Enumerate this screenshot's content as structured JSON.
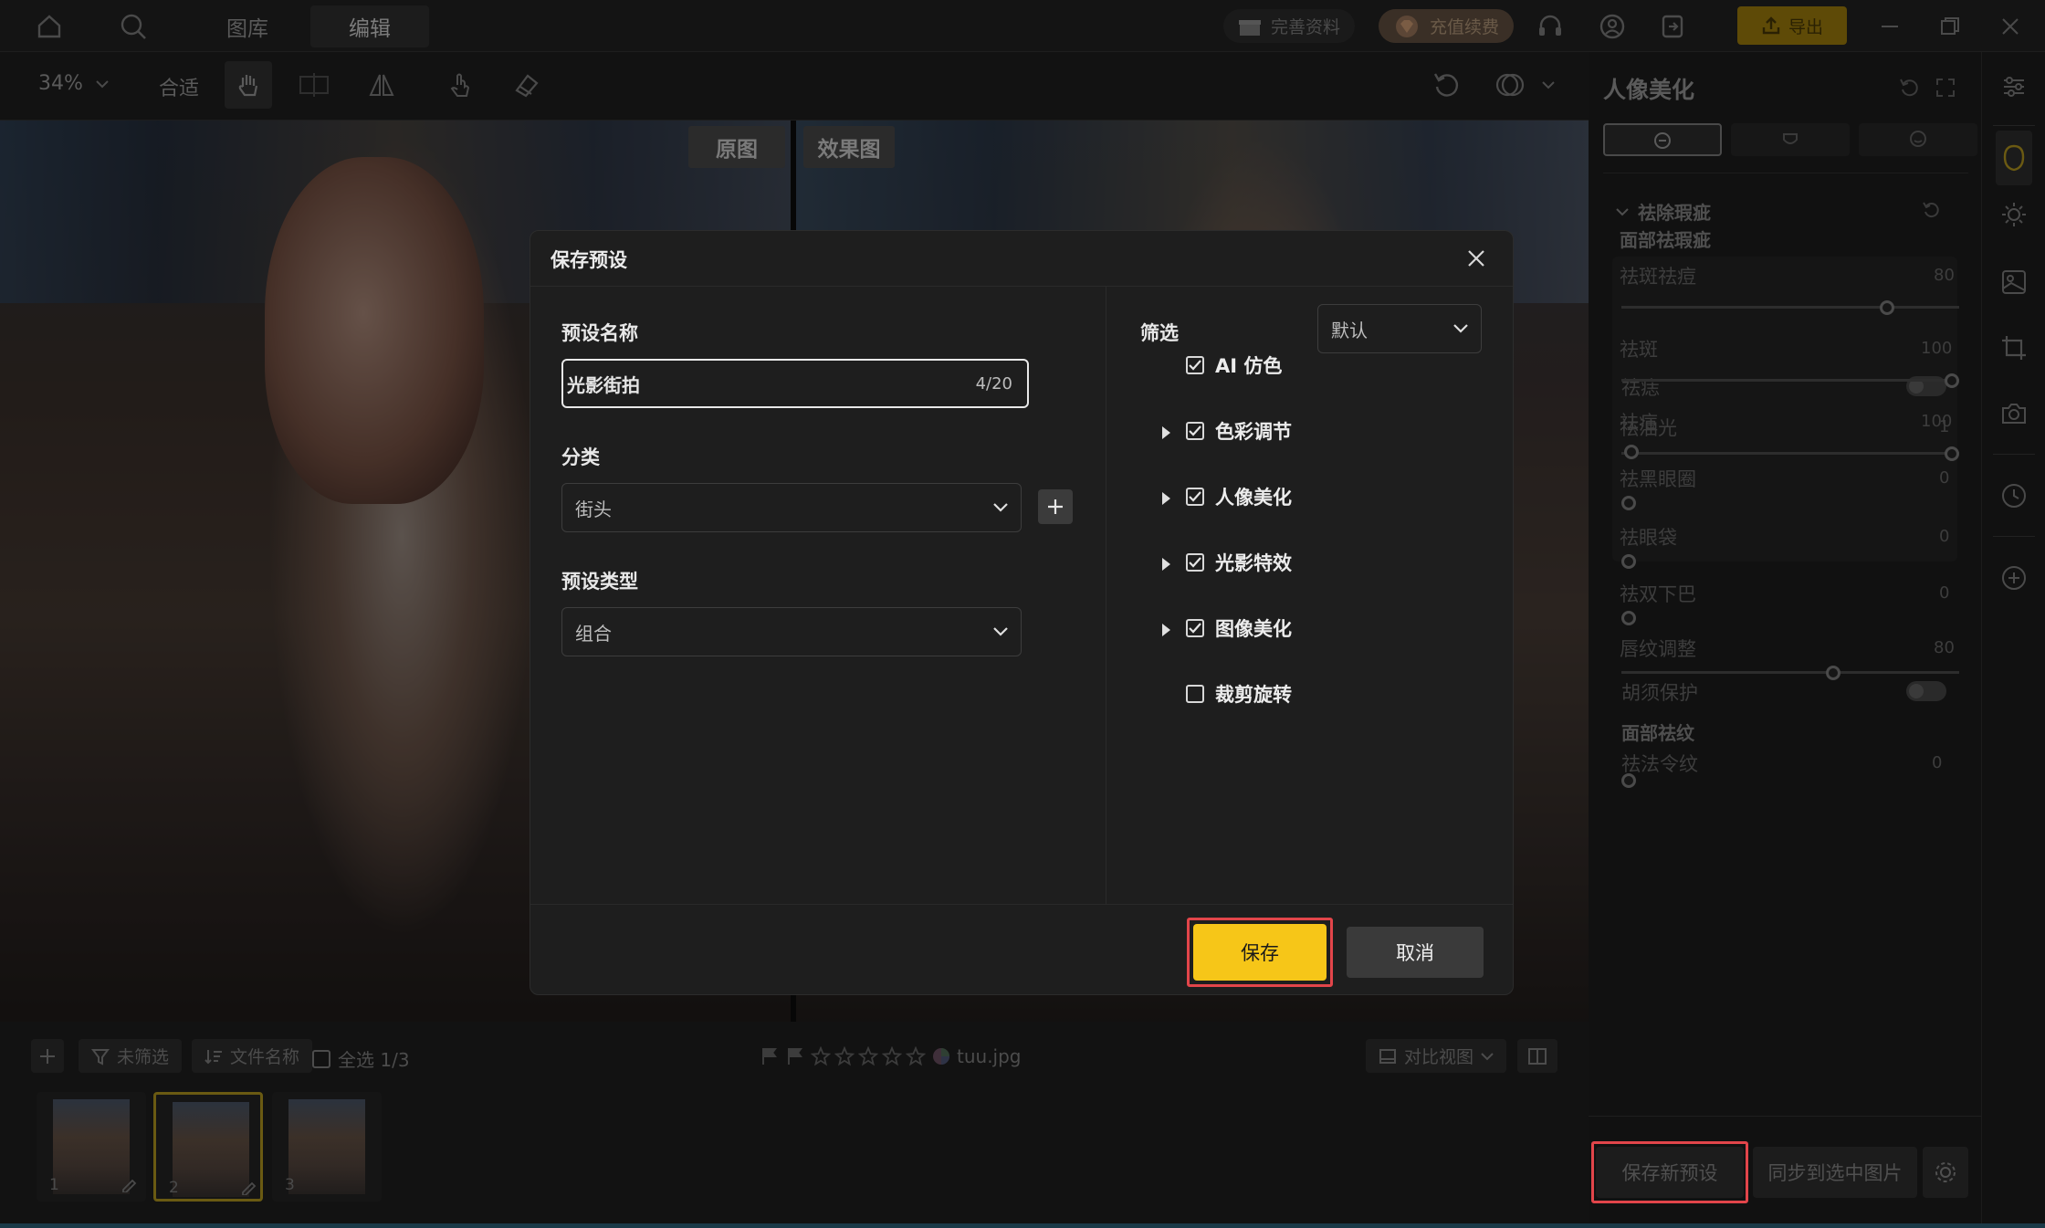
{
  "topbar": {
    "tabs": [
      "图库",
      "编辑"
    ],
    "complete_profile": "完善资料",
    "recharge": "充值续费",
    "export": "导出"
  },
  "toolbar": {
    "zoom": "34%",
    "fit": "合适"
  },
  "canvas": {
    "original_label": "原图",
    "effect_label": "效果图"
  },
  "modal": {
    "title": "保存预设",
    "name_label": "预设名称",
    "name_value": "光影街拍",
    "name_count": "4/20",
    "category_label": "分类",
    "category_value": "街头",
    "type_label": "预设类型",
    "type_value": "组合",
    "filter_label": "筛选",
    "filter_value": "默认",
    "options": [
      {
        "label": "AI 仿色",
        "checked": true,
        "expandable": false
      },
      {
        "label": "色彩调节",
        "checked": true,
        "expandable": true
      },
      {
        "label": "人像美化",
        "checked": true,
        "expandable": true
      },
      {
        "label": "光影特效",
        "checked": true,
        "expandable": true
      },
      {
        "label": "图像美化",
        "checked": true,
        "expandable": true
      },
      {
        "label": "裁剪旋转",
        "checked": false,
        "expandable": false
      }
    ],
    "save_label": "保存",
    "cancel_label": "取消"
  },
  "panel": {
    "title": "人像美化",
    "section_blemish": "祛除瑕疵",
    "subsection_face": "面部祛瑕疵",
    "sliders": [
      {
        "label": "祛斑祛痘",
        "value": "80",
        "level": 0.8
      },
      {
        "label": "祛斑",
        "value": "100",
        "level": 1.0
      },
      {
        "label": "祛痘",
        "value": "100",
        "level": 1.0
      }
    ],
    "toggle_mole": "祛痣",
    "sliders2": [
      {
        "label": "祛油光",
        "value": "1",
        "level": 0.01
      },
      {
        "label": "祛黑眼圈",
        "value": "0",
        "level": 0.0
      },
      {
        "label": "祛眼袋",
        "value": "0",
        "level": 0.0
      },
      {
        "label": "祛双下巴",
        "value": "0",
        "level": 0.0
      },
      {
        "label": "唇纹调整",
        "value": "80",
        "level": 0.8
      }
    ],
    "toggle_beard": "胡须保护",
    "subsection_wrinkle": "面部祛纹",
    "slider_nasolabial": {
      "label": "祛法令纹",
      "value": "0",
      "level": 0.0
    },
    "save_new_preset": "保存新预设",
    "sync_selected": "同步到选中图片"
  },
  "bottom": {
    "unfiltered": "未筛选",
    "filename": "文件名称",
    "select_all": "全选 1/3",
    "file": "tuu.jpg",
    "compare_view": "对比视图",
    "thumbs": [
      "1",
      "2",
      "3"
    ]
  }
}
